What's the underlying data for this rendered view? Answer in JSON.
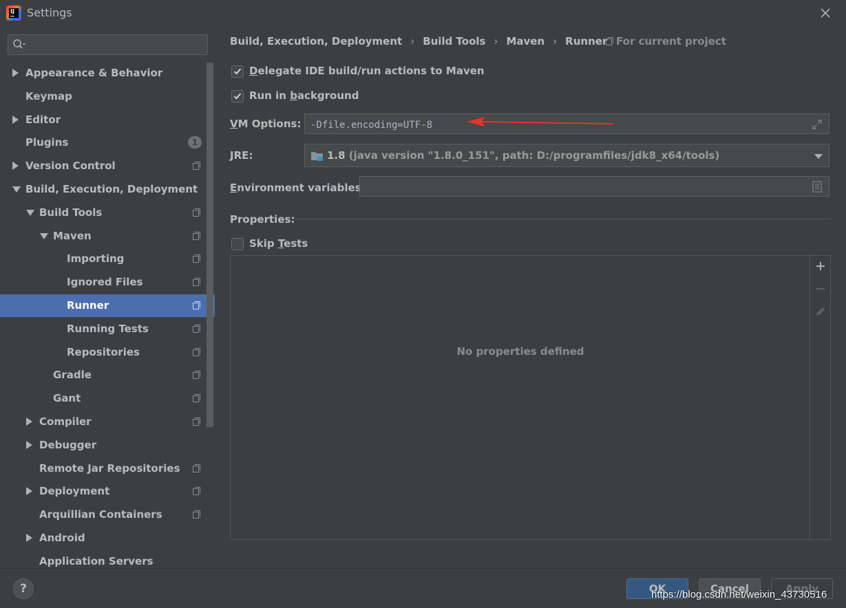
{
  "window": {
    "title": "Settings"
  },
  "search": {
    "placeholder": ""
  },
  "tree": [
    {
      "label": "Appearance & Behavior",
      "arrow": "right",
      "project": false
    },
    {
      "label": "Keymap",
      "arrow": "",
      "project": false
    },
    {
      "label": "Editor",
      "arrow": "right",
      "project": false
    },
    {
      "label": "Plugins",
      "arrow": "",
      "project": false,
      "badge": "1"
    },
    {
      "label": "Version Control",
      "arrow": "right",
      "project": true
    },
    {
      "label": "Build, Execution, Deployment",
      "arrow": "down",
      "project": false
    },
    {
      "label": "Build Tools",
      "arrow": "down",
      "project": true
    },
    {
      "label": "Maven",
      "arrow": "down",
      "project": true
    },
    {
      "label": "Importing",
      "arrow": "",
      "project": true
    },
    {
      "label": "Ignored Files",
      "arrow": "",
      "project": true
    },
    {
      "label": "Runner",
      "arrow": "",
      "project": true,
      "selected": true
    },
    {
      "label": "Running Tests",
      "arrow": "",
      "project": true
    },
    {
      "label": "Repositories",
      "arrow": "",
      "project": true
    },
    {
      "label": "Gradle",
      "arrow": "",
      "project": true
    },
    {
      "label": "Gant",
      "arrow": "",
      "project": true
    },
    {
      "label": "Compiler",
      "arrow": "right",
      "project": true
    },
    {
      "label": "Debugger",
      "arrow": "right",
      "project": false
    },
    {
      "label": "Remote Jar Repositories",
      "arrow": "",
      "project": true
    },
    {
      "label": "Deployment",
      "arrow": "right",
      "project": true
    },
    {
      "label": "Arquillian Containers",
      "arrow": "",
      "project": true
    },
    {
      "label": "Android",
      "arrow": "right",
      "project": false
    },
    {
      "label": "Application Servers",
      "arrow": "",
      "project": false
    }
  ],
  "breadcrumb": {
    "items": [
      "Build, Execution, Deployment",
      "Build Tools",
      "Maven",
      "Runner"
    ],
    "separator": "›",
    "scope": "For current project"
  },
  "runner": {
    "delegate": {
      "label_pre": "",
      "label_mnemonic": "D",
      "label_post": "elegate IDE build/run actions to Maven",
      "checked": true
    },
    "background": {
      "label_pre": "Run in ",
      "label_mnemonic": "b",
      "label_post": "ackground",
      "checked": true
    },
    "vm_options": {
      "label_mnemonic": "V",
      "label_post": "M Options:",
      "value": "-Dfile.encoding=UTF-8"
    },
    "jre": {
      "label_mnemonic": "J",
      "label_post": "RE:",
      "version": "1.8",
      "detail": "(java version \"1.8.0_151\", path: D:/programfiles/jdk8_x64/tools)"
    },
    "env": {
      "label_mnemonic": "E",
      "label_post": "nvironment variables:",
      "value": ""
    },
    "properties": {
      "title": "Properties:",
      "empty_text": "No properties defined"
    },
    "skip_tests": {
      "label_pre": "Skip ",
      "label_mnemonic": "T",
      "label_post": "ests",
      "checked": false
    }
  },
  "footer": {
    "help": "?",
    "ok": "OK",
    "cancel": "Cancel",
    "apply": "Apply",
    "watermark": "https://blog.csdn.net/weixin_43730516"
  },
  "colors": {
    "background": "#3c3f41",
    "selection": "#4b6eaf",
    "annotation_arrow": "#e8312f",
    "ok_button": "#365880"
  }
}
